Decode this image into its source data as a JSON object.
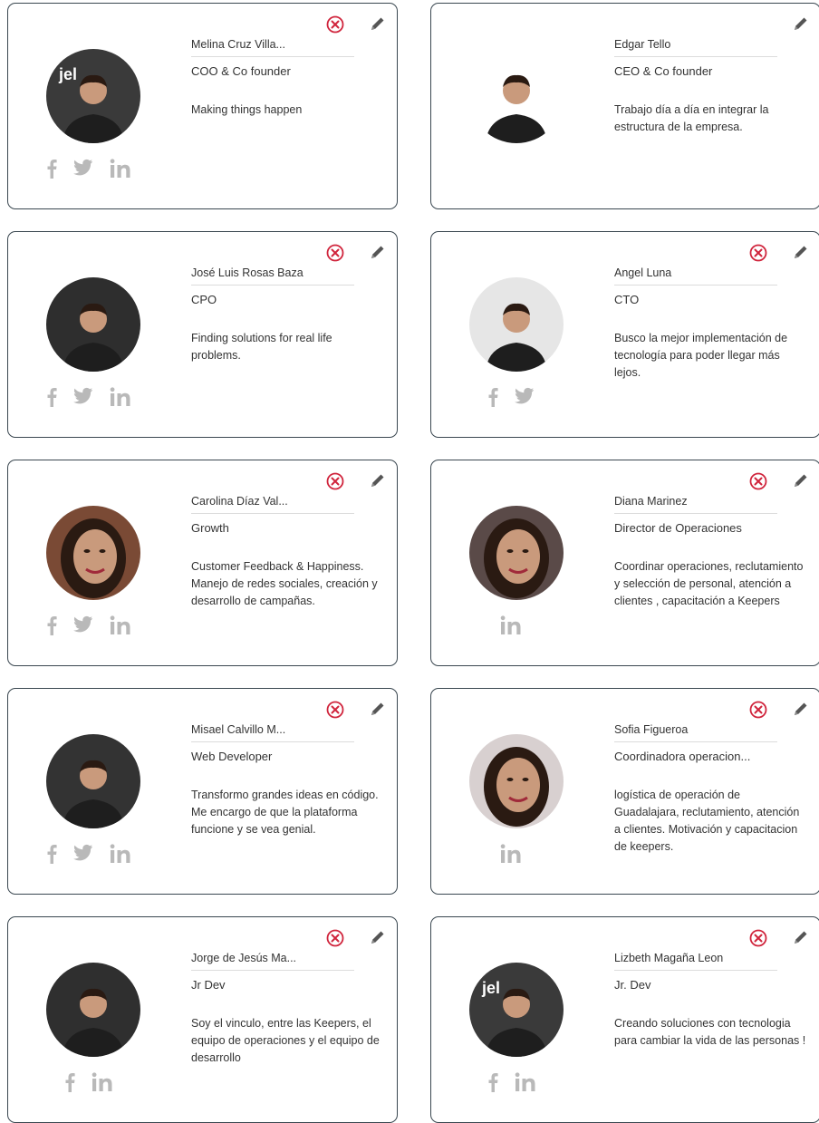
{
  "colors": {
    "delete": "#d0243c",
    "icon_gray": "#b9b9b9",
    "edit": "#555555",
    "border": "#3a4750"
  },
  "members": [
    {
      "name": "Melina Cruz Villa...",
      "role": "COO & Co founder",
      "description": "Making things happen",
      "socials": [
        "facebook-icon",
        "twitter-icon",
        "linkedin-icon"
      ],
      "deletable": true,
      "bg": "#3a3a3a"
    },
    {
      "name": "Edgar Tello",
      "role": "CEO & Co founder",
      "description": "Trabajo día a día en integrar la estructura de la empresa.",
      "socials": [],
      "deletable": false,
      "bg": "#ffffff"
    },
    {
      "name": "José Luis Rosas Baza",
      "role": "CPO",
      "description": "Finding solutions for real life problems.",
      "socials": [
        "facebook-icon",
        "twitter-icon",
        "linkedin-icon"
      ],
      "deletable": true,
      "bg": "#2e2e2e"
    },
    {
      "name": "Angel Luna",
      "role": "CTO",
      "description": "Busco la mejor implementación de tecnología para poder llegar más lejos.",
      "socials": [
        "facebook-icon",
        "twitter-icon"
      ],
      "deletable": true,
      "bg": "#e6e6e6"
    },
    {
      "name": "Carolina Díaz Val...",
      "role": "Growth",
      "description": "Customer Feedback & Happiness. Manejo de redes sociales, creación y desarrollo de campañas.",
      "socials": [
        "facebook-icon",
        "twitter-icon",
        "linkedin-icon"
      ],
      "deletable": true,
      "bg": "#7a4a35"
    },
    {
      "name": "Diana Marinez",
      "role": "Director de Operaciones",
      "description": "Coordinar operaciones, reclutamiento y selección de personal, atención a clientes , capacitación a Keepers",
      "socials": [
        "linkedin-icon"
      ],
      "deletable": true,
      "bg": "#5a4a48"
    },
    {
      "name": "Misael Calvillo M...",
      "role": "Web Developer",
      "description": "Transformo grandes ideas en código. Me encargo de que la plataforma funcione y se vea genial.",
      "socials": [
        "facebook-icon",
        "twitter-icon",
        "linkedin-icon"
      ],
      "deletable": true,
      "bg": "#333333"
    },
    {
      "name": "Sofia Figueroa",
      "role": "Coordinadora operacion...",
      "description": "logística de operación de Guadalajara, reclutamiento, atención a clientes. Motivación y capacitacion de keepers.",
      "socials": [
        "linkedin-icon"
      ],
      "deletable": true,
      "bg": "#d8d0d0"
    },
    {
      "name": "Jorge de Jesús Ma...",
      "role": "Jr Dev",
      "description": "Soy el vinculo, entre las Keepers, el equipo de operaciones y el equipo de desarrollo",
      "socials": [
        "facebook-icon",
        "linkedin-icon"
      ],
      "deletable": true,
      "bg": "#2f2f2f"
    },
    {
      "name": "Lizbeth Magaña Leon",
      "role": "Jr. Dev",
      "description": "Creando soluciones con tecnologia para cambiar la vida de las personas !",
      "socials": [
        "facebook-icon",
        "linkedin-icon"
      ],
      "deletable": true,
      "bg": "#3a3a3a"
    }
  ]
}
